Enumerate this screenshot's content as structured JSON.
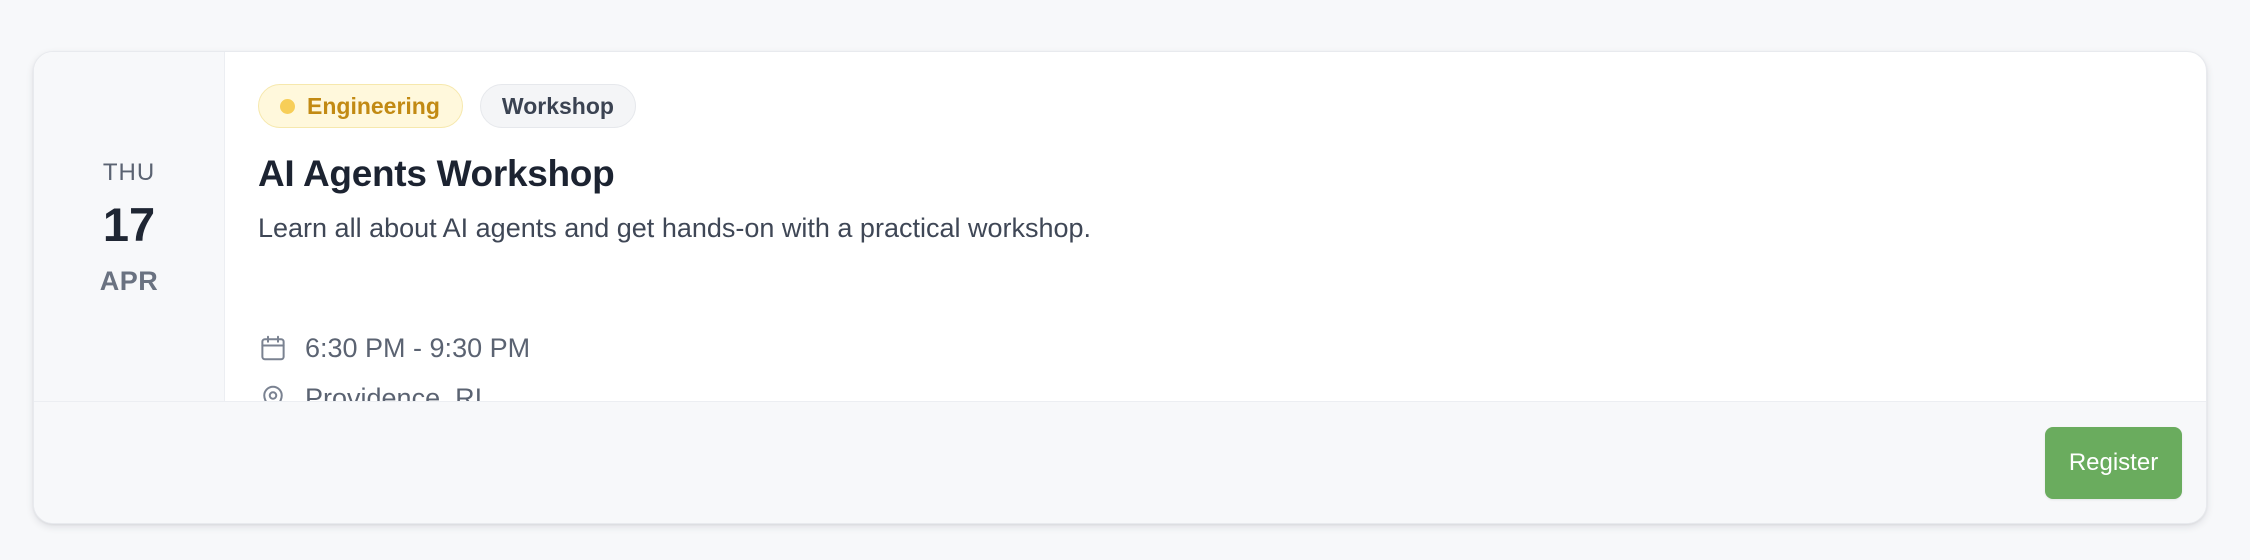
{
  "event": {
    "date": {
      "weekday": "THU",
      "day": "17",
      "month": "APR"
    },
    "tags": [
      {
        "label": "Engineering",
        "color": "#c28a13",
        "dot_color": "#f7ce58"
      },
      {
        "label": "Workshop",
        "color": "#3b4352"
      }
    ],
    "title": "AI Agents Workshop",
    "description": "Learn all about AI agents and get hands-on with a practical workshop.",
    "time": "6:30 PM - 9:30 PM",
    "time_icon": "calendar-icon",
    "location": "Providence, RI",
    "location_icon": "map-pin-icon"
  },
  "footer": {
    "register_label": "Register",
    "register_color": "#6aac5e"
  }
}
